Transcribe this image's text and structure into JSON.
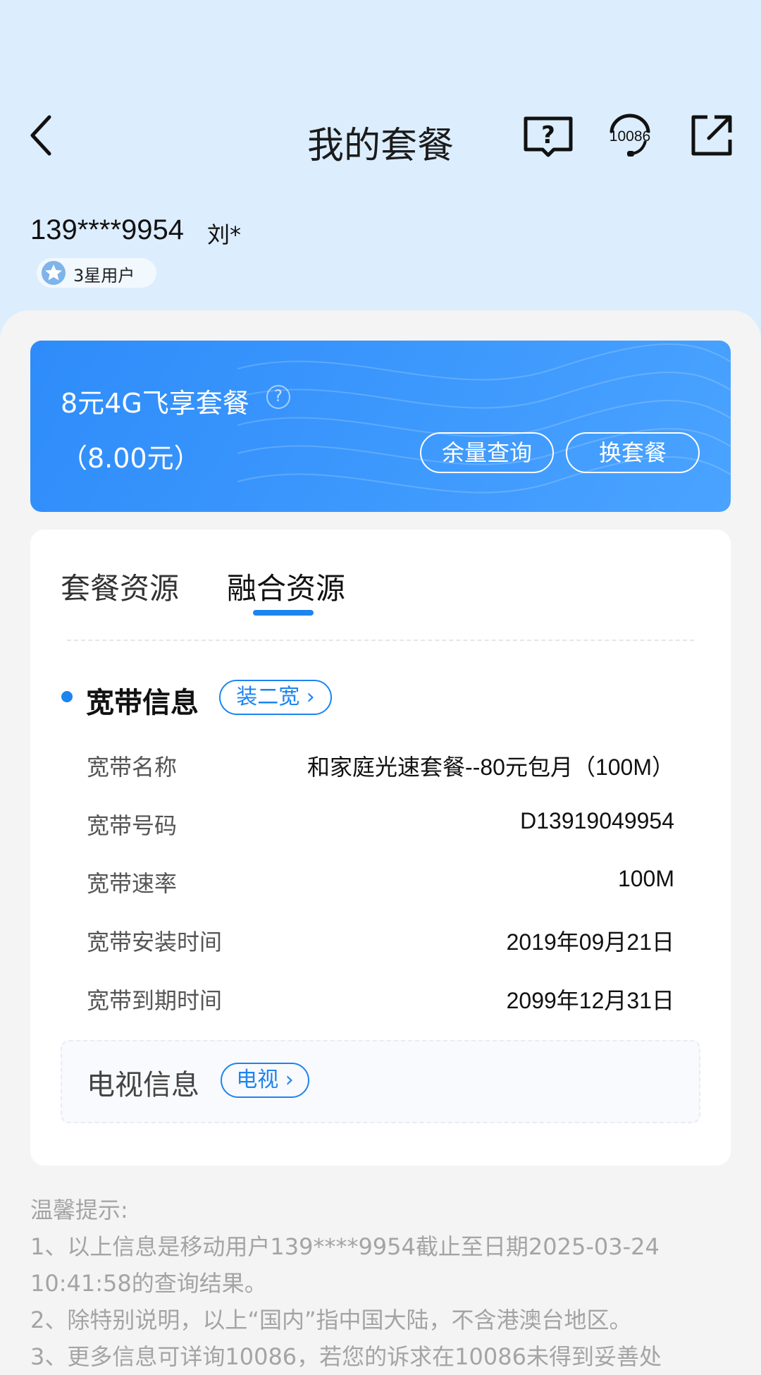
{
  "nav": {
    "title": "我的套餐",
    "icons": [
      "back-icon",
      "help-book-icon",
      "customer-service-icon",
      "share-icon"
    ],
    "service_number": "10086"
  },
  "user": {
    "number": "139****9954",
    "name": "刘*",
    "level": "3星用户"
  },
  "plan": {
    "name": "8元4G飞享套餐",
    "price": "（8.00元）",
    "balance_button": "余量查询",
    "change_button": "换套餐"
  },
  "tabs": [
    {
      "label": "套餐资源",
      "active": false
    },
    {
      "label": "融合资源",
      "active": true
    }
  ],
  "broadband": {
    "title": "宽带信息",
    "action": "装二宽",
    "rows": [
      {
        "label": "宽带名称",
        "value": "和家庭光速套餐--80元包月（100M）"
      },
      {
        "label": "宽带号码",
        "value": "D13919049954"
      },
      {
        "label": "宽带速率",
        "value": "100M"
      },
      {
        "label": "宽带安装时间",
        "value": "2019年09月21日"
      },
      {
        "label": "宽带到期时间",
        "value": "2099年12月31日"
      }
    ]
  },
  "tv": {
    "title": "电视信息",
    "action": "电视"
  },
  "tips": {
    "heading": "温馨提示:",
    "lines": [
      "1、以上信息是移动用户139****9954截止至日期2025-03-24",
      "10:41:58的查询结果。",
      "2、除特别说明，以上“国内”指中国大陆，不含港澳台地区。",
      "3、更多信息可详询10086，若您的诉求在10086未得到妥善处"
    ]
  },
  "colors": {
    "header_bg": "#dcedfd",
    "accent": "#1d84f0",
    "plan_card": "#3b97fb",
    "page_bg": "#f4f4f4"
  }
}
